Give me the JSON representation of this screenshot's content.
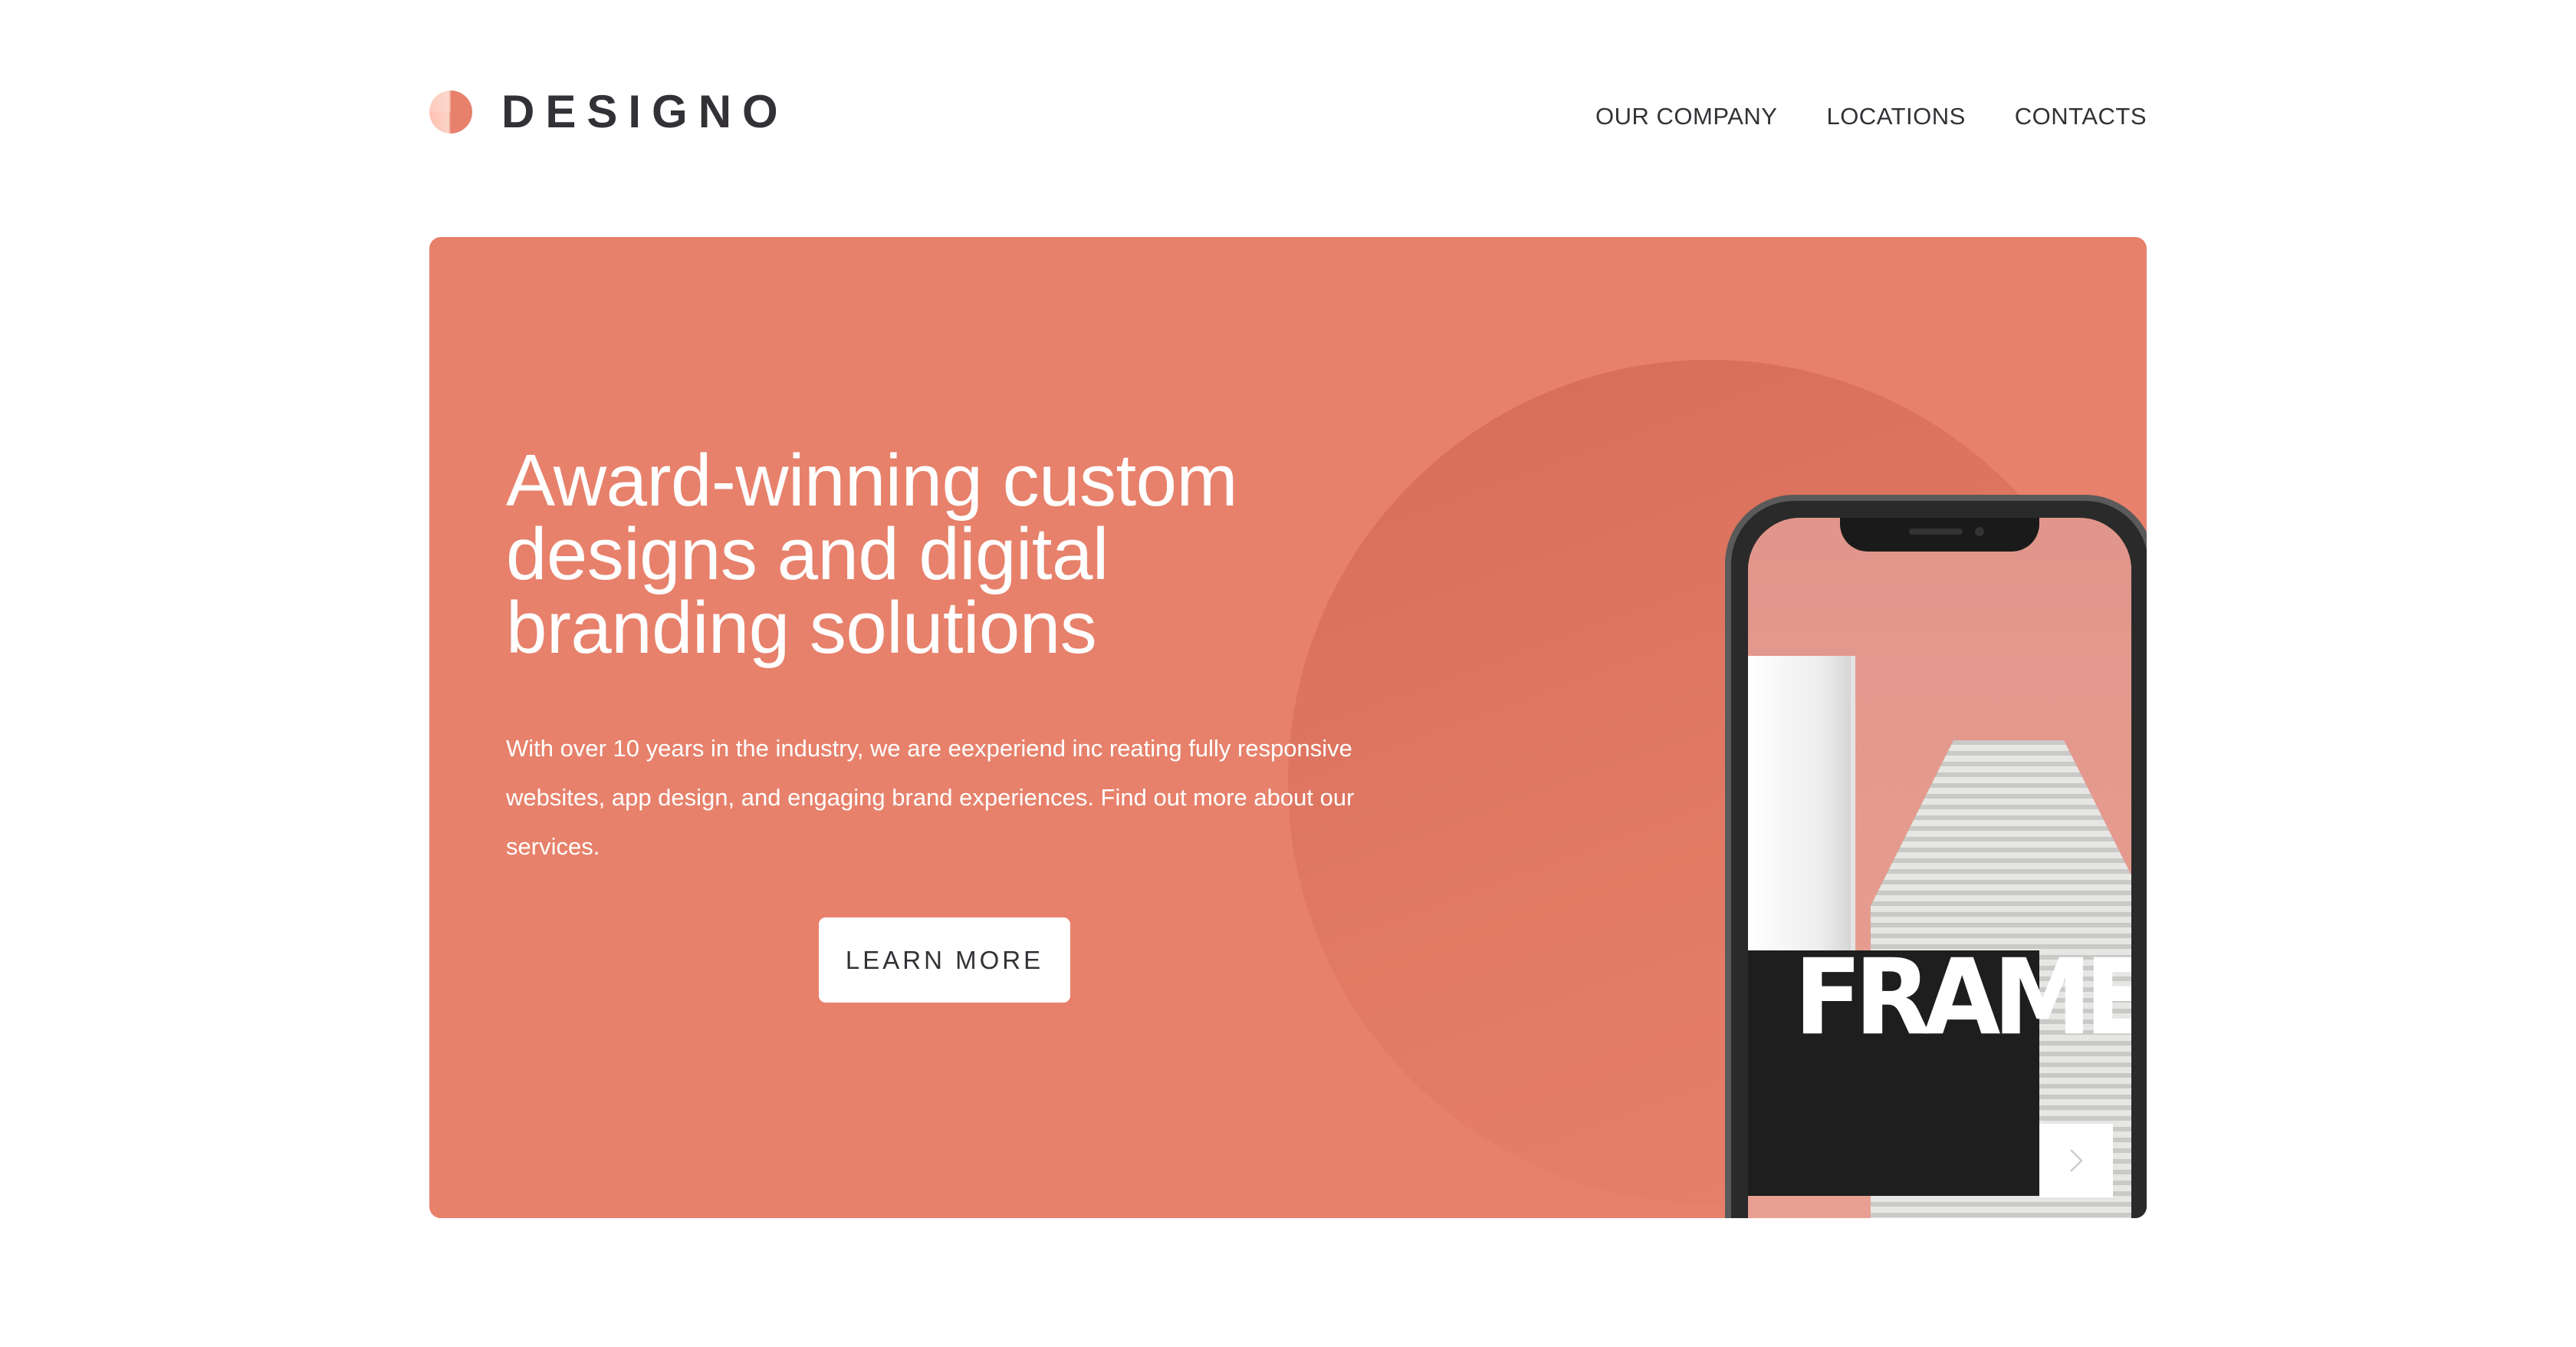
{
  "brand": {
    "name": "DESIGNO",
    "accent_color": "#e7816b",
    "logo_icon": "half-circle-logo-icon"
  },
  "nav": {
    "items": [
      {
        "label": "OUR COMPANY"
      },
      {
        "label": "LOCATIONS"
      },
      {
        "label": "CONTACTS"
      }
    ]
  },
  "hero": {
    "title_lines": [
      "Award-winning custom",
      "designs and digital",
      "branding solutions"
    ],
    "description": "With over 10 years in the industry, we are eexperiend inc reating fully responsive websites, app design, and engaging brand experiences. Find out more about our services.",
    "cta_label": "LEARN MORE",
    "phone_screen": {
      "headline": "FRAME",
      "next_icon": "chevron-right-icon"
    }
  }
}
